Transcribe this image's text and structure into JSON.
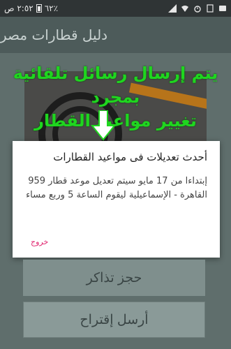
{
  "status_bar": {
    "time": "٢:٥٢ ص",
    "battery_percent": "٦٢٪",
    "icons": [
      "alarm-icon",
      "signal-icon",
      "wifi-icon",
      "sim-icon",
      "notification-icon"
    ]
  },
  "app_bar": {
    "title": "دليل قطارات مصر"
  },
  "overlay": {
    "line1": "يتم إرسال رسائل تلقائية بمجرد",
    "line2": "تغيير مواعيد القطار",
    "color": "#1fd61f"
  },
  "dialog": {
    "title": "أحدث تعديلات فى مواعيد القطارات",
    "body": "إبتداءا من 17 مايو سيتم تعديل موعد قطار 959 القاهرة - الإسماعيلية ليقوم الساعة 5 وربع مساء",
    "exit_label": "خروج",
    "exit_color": "#e0246f"
  },
  "buttons": {
    "book_tickets": "حجز تذاكر",
    "send_suggestion": "أرسل إقتراح"
  }
}
